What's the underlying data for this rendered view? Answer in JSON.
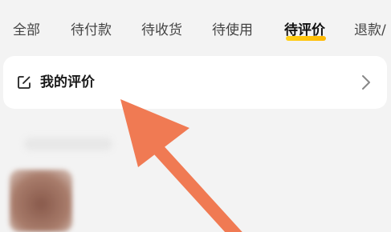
{
  "tabs": [
    {
      "label": "全部",
      "active": false
    },
    {
      "label": "待付款",
      "active": false
    },
    {
      "label": "待收货",
      "active": false
    },
    {
      "label": "待使用",
      "active": false
    },
    {
      "label": "待评价",
      "active": true
    },
    {
      "label": "退款/",
      "active": false
    }
  ],
  "review_card": {
    "title": "我的评价",
    "icon": "edit-icon",
    "trailing_icon": "chevron-right-icon"
  },
  "annotation": {
    "icon": "arrow-pointer",
    "color": "#f07a53"
  },
  "accent_color": "#ffc300"
}
